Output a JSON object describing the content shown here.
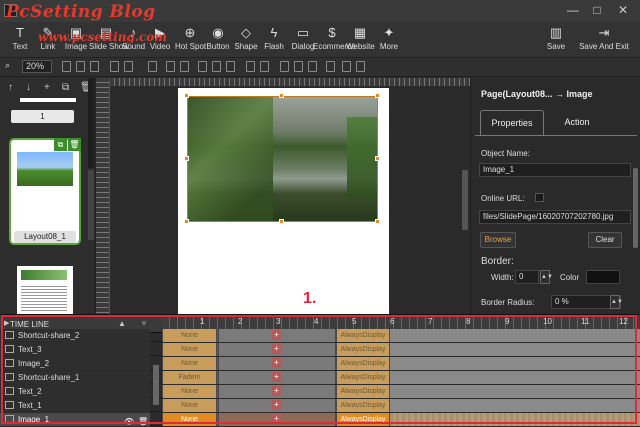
{
  "watermark": {
    "title": "PcSetting Blog",
    "url": "www.pcsetting.com"
  },
  "window": {
    "minimize": "—",
    "maximize": "□",
    "close": "✕"
  },
  "toolbar": {
    "items": [
      {
        "label": "Text",
        "icon": "T"
      },
      {
        "label": "Link",
        "icon": "✎"
      },
      {
        "label": "Image",
        "icon": "▣"
      },
      {
        "label": "Slide Show",
        "icon": "▤"
      },
      {
        "label": "Sound",
        "icon": "♪"
      },
      {
        "label": "Video",
        "icon": "▶"
      },
      {
        "label": "Hot Spot",
        "icon": "⊕"
      },
      {
        "label": "Button",
        "icon": "◉"
      },
      {
        "label": "Shape",
        "icon": "◇"
      },
      {
        "label": "Flash",
        "icon": "ϟ"
      },
      {
        "label": "Dialog",
        "icon": "▭"
      },
      {
        "label": "Ecommerce",
        "icon": "$"
      },
      {
        "label": "Website",
        "icon": "▦"
      },
      {
        "label": "More",
        "icon": "✦"
      }
    ],
    "save_label": "Save",
    "save_exit_label": "Save And Exit"
  },
  "toolbar2": {
    "zoom_value": "20%"
  },
  "pages": {
    "page_number": "1",
    "thumb_label": "Layout08_1"
  },
  "properties": {
    "header": "Page(Layout08... → Image",
    "tabs": [
      "Properties",
      "Action"
    ],
    "object_name_label": "Object Name:",
    "object_name_value": "Image_1",
    "online_url_label": "Online URL:",
    "file_path": "files/SlidePage/16020707202780.jpg",
    "browse_label": "Browse",
    "clear_label": "Clear",
    "border_label": "Border:",
    "width_label": "Width:",
    "width_value": "0",
    "color_label": "Color",
    "border_radius_label": "Border Radius:",
    "border_radius_value": "0 %"
  },
  "annotation": "1.",
  "timeline": {
    "title": "TIME LINE",
    "ticks": [
      "1",
      "2",
      "3",
      "4",
      "5",
      "6",
      "7",
      "8",
      "9",
      "10",
      "11",
      "12"
    ],
    "rows": [
      {
        "name": "Shortcut-share_2",
        "in": "None",
        "out": "AlwaysDisplay"
      },
      {
        "name": "Text_3",
        "in": "None",
        "out": "AlwaysDisplay"
      },
      {
        "name": "Image_2",
        "in": "None",
        "out": "AlwaysDisplay"
      },
      {
        "name": "Shortcut-share_1",
        "in": "FadeIn",
        "out": "AlwaysDisplay"
      },
      {
        "name": "Text_2",
        "in": "None",
        "out": "AlwaysDisplay"
      },
      {
        "name": "Text_1",
        "in": "None",
        "out": "AlwaysDisplay"
      },
      {
        "name": "Image_1",
        "in": "None",
        "out": "AlwaysDisplay"
      }
    ]
  }
}
